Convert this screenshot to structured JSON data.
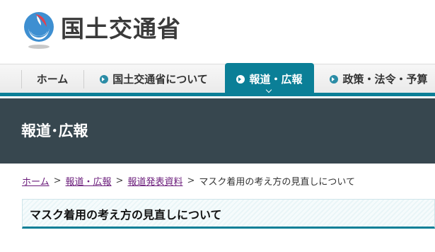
{
  "header": {
    "logo_text": "国土交通省",
    "colors": {
      "brand_blue": "#3e8fd1",
      "brand_red": "#e2404f",
      "text": "#3a3a3a"
    }
  },
  "nav": {
    "items": [
      {
        "label": "ホーム",
        "active": false
      },
      {
        "label": "国土交通省について",
        "active": false
      },
      {
        "label": "報道・広報",
        "active": true
      },
      {
        "label": "政策・法令・予算",
        "active": false
      }
    ],
    "accent": "#0b7f97",
    "active_icon": "chevron-down-icon"
  },
  "banner": {
    "title": "報道･広報",
    "background": "#37474f"
  },
  "breadcrumb": {
    "items": [
      {
        "label": "ホーム",
        "link": true
      },
      {
        "label": "報道・広報",
        "link": true
      },
      {
        "label": "報道発表資料",
        "link": true
      },
      {
        "label": "マスク着用の考え方の見直しについて",
        "link": false
      }
    ],
    "separator": ">"
  },
  "page": {
    "title": "マスク着用の考え方の見直しについて"
  }
}
